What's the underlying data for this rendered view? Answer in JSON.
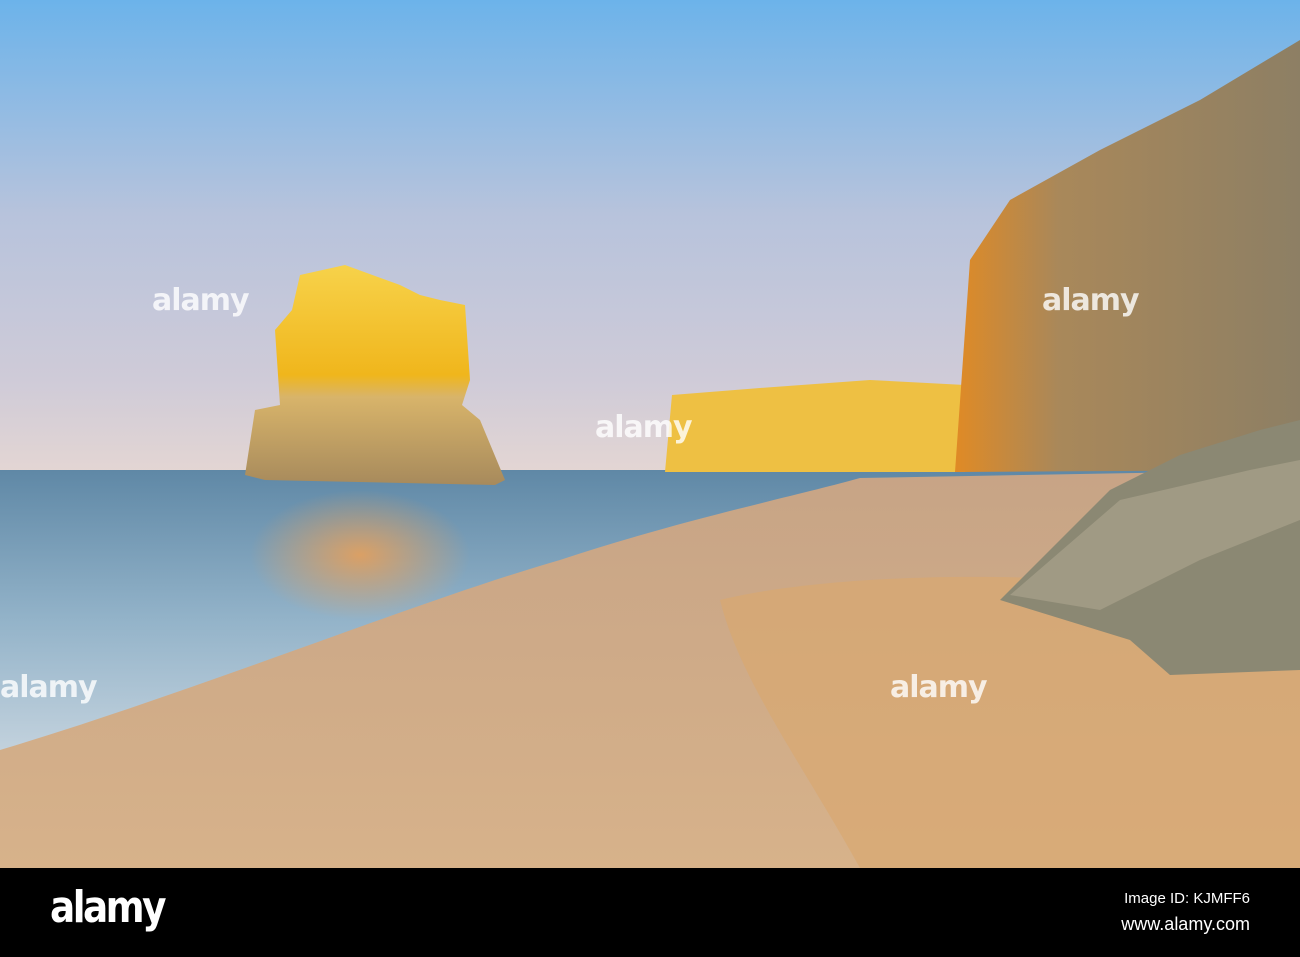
{
  "photo": {
    "subject": "Sea stack and cliffs on sandy beach at sunrise"
  },
  "watermark": {
    "text": "alamy"
  },
  "footer": {
    "logo": "alamy",
    "image_id": "Image ID: KJMFF6",
    "url": "www.alamy.com"
  },
  "colors": {
    "sky_top": "#6cb3ea",
    "horizon": "#ddd3d6",
    "sea": "#8fb0c8",
    "sand": "#d3ae86",
    "rock_glow": "#f2b91e"
  }
}
